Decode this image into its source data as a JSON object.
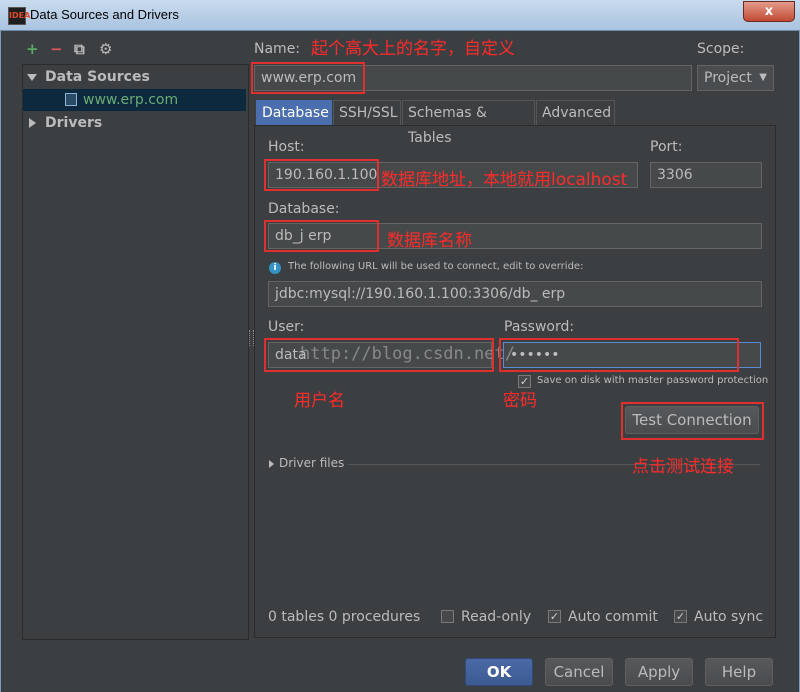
{
  "window": {
    "title": "Data Sources and Drivers",
    "close_label": "x",
    "app_icon_text": "IDEA"
  },
  "toolbar": {
    "add": "+",
    "remove": "−",
    "copy": "⧉",
    "settings": "⚙"
  },
  "tree": {
    "sections": [
      {
        "label": "Data Sources"
      },
      {
        "label": "Drivers"
      }
    ],
    "datasource": {
      "label": "www.erp.com"
    }
  },
  "form": {
    "name_label": "Name:",
    "name_value": "www.erp.com",
    "scope_label": "Scope:",
    "scope_value": "Project",
    "tabs": [
      "Database",
      "SSH/SSL",
      "Schemas & Tables",
      "Advanced"
    ],
    "host_label": "Host:",
    "host_value": "190.160.1.100",
    "port_label": "Port:",
    "port_value": "3306",
    "database_label": "Database:",
    "database_value": "db_j    erp",
    "url_info": "The following URL will be used to connect, edit to override:",
    "url_value": "jdbc:mysql://190.160.1.100:3306/db_     erp",
    "user_label": "User:",
    "user_value": "         data",
    "password_label": "Password:",
    "password_value": "••••••",
    "save_on_disk": "Save on disk with master password protection",
    "test_connection": "Test Connection",
    "driver_files": "Driver files",
    "summary": "0 tables 0 procedures",
    "read_only": "Read-only",
    "auto_commit": "Auto commit",
    "auto_sync": "Auto sync"
  },
  "buttons": {
    "ok": "OK",
    "cancel": "Cancel",
    "apply": "Apply",
    "help": "Help"
  },
  "annotations": {
    "name": "起个高大上的名字，自定义",
    "host": "数据库地址，本地就用localhost",
    "database": "数据库名称",
    "user": "用户名",
    "password": "密码",
    "test": "点击测试连接"
  },
  "watermark": "http://blog.csdn.net/",
  "colors": {
    "accent": "#4b6eaf",
    "annotation": "#e02f2f",
    "datasource": "#6aab73"
  }
}
